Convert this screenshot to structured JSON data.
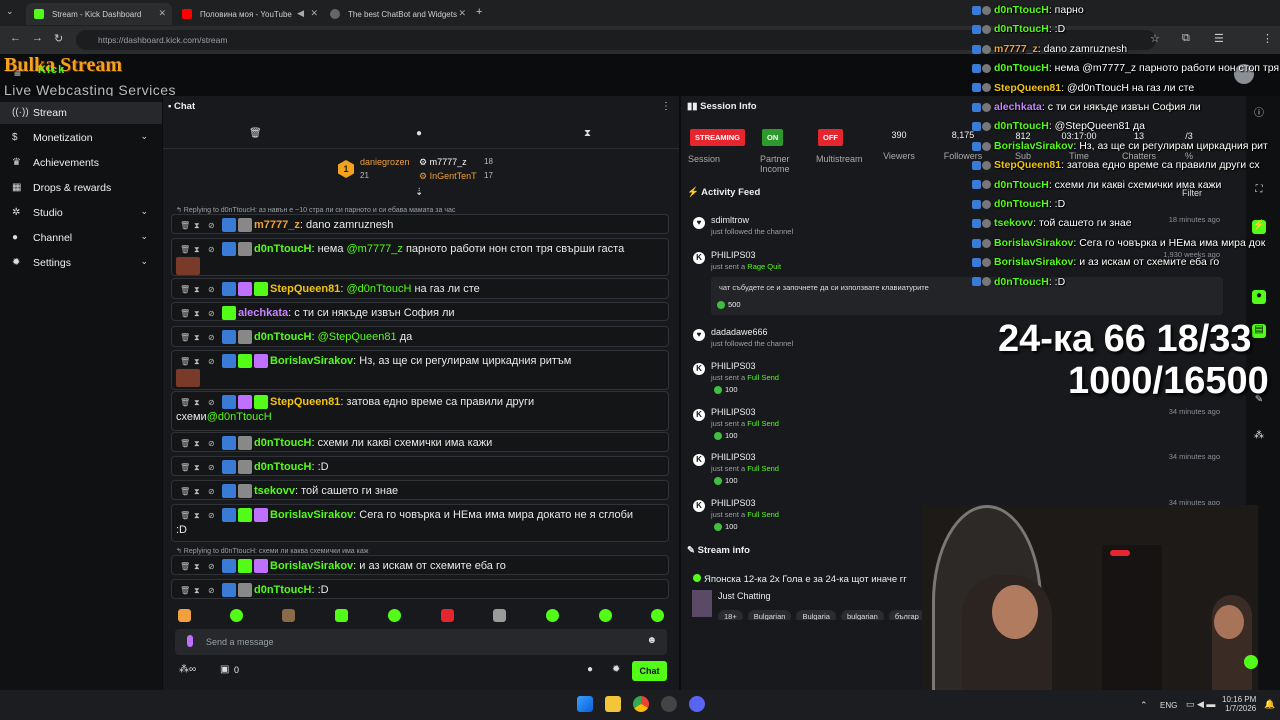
{
  "browser": {
    "tabs": [
      {
        "title": "Stream - Kick Dashboard",
        "fav_color": "#53fc18"
      },
      {
        "title": "Половина моя - YouTube",
        "fav_color": "#ff0000"
      },
      {
        "title": "The best ChatBot and Widgets",
        "fav_color": "#888888"
      }
    ],
    "url": "https://dashboard.kick.com/stream"
  },
  "logo": {
    "title": "Bulka Stream",
    "subtitle": "Live Webcasting Services",
    "badge": "Kick"
  },
  "sidebar": {
    "items": [
      {
        "label": "Stream",
        "icon": "stream-icon",
        "glyph": "((·))",
        "active": true
      },
      {
        "label": "Monetization",
        "icon": "dollar-icon",
        "glyph": "$",
        "chev": true
      },
      {
        "label": "Achievements",
        "icon": "trophy-icon",
        "glyph": "♛"
      },
      {
        "label": "Drops & rewards",
        "icon": "gift-icon",
        "glyph": "▦"
      },
      {
        "label": "Studio",
        "icon": "settings-icon",
        "glyph": "✲",
        "chev": true
      },
      {
        "label": "Channel",
        "icon": "user-icon",
        "glyph": "●",
        "chev": true
      },
      {
        "label": "Settings",
        "icon": "gear-icon",
        "glyph": "✹",
        "chev": true
      }
    ]
  },
  "chat": {
    "title": "Chat",
    "top_users": [
      {
        "name": "daniegrozen",
        "count": "21",
        "rank": "1"
      },
      {
        "name": "m7777_z",
        "count": "18"
      },
      {
        "name": "InGentTenT",
        "count": "17"
      }
    ],
    "reply1": "↰ Replying to d0nTtoucH: аз навън е ~10 стра ли си парното и си ебава мамата за час",
    "reply2": "↰ Replying to d0nTtoucH: схеми ли каква схемички има каж",
    "messages": [
      {
        "user": "m7777_z",
        "color": "#f0a03c",
        "text": ": dano zamruznesh"
      },
      {
        "user": "d0nTtoucH",
        "color": "#53fc18",
        "text": ": нема ",
        "mention": "@m7777_z",
        "text2": " парното работи нон стоп тря свърши гаста"
      },
      {
        "user": "StepQueen81",
        "color": "#f1c40f",
        "text": ": ",
        "mention": "@d0nTtoucH",
        "text2": " на газ ли сте"
      },
      {
        "user": "alechkata",
        "color": "#c784ff",
        "text": ": с ти си някъде извън София ли"
      },
      {
        "user": "d0nTtoucH",
        "color": "#53fc18",
        "text": ": ",
        "mention": "@StepQueen81",
        "text2": " да"
      },
      {
        "user": "BorislavSirakov",
        "color": "#53fc18",
        "text": ": Нз, аз ще си регулирам циркадния ритъм"
      },
      {
        "user": "StepQueen81",
        "color": "#f1c40f",
        "text": ": затова едно време са правили други",
        "line2": "схеми",
        "mention2": "@d0nTtoucH"
      },
      {
        "user": "d0nTtoucH",
        "color": "#53fc18",
        "text": ": схеми ли каквi схемички има кажи"
      },
      {
        "user": "d0nTtoucH",
        "color": "#53fc18",
        "text": ": :D"
      },
      {
        "user": "tsekovv",
        "color": "#53fc18",
        "text": ": той сашето ги знае"
      },
      {
        "user": "BorislavSirakov",
        "color": "#53fc18",
        "text": ": Сега го човърка и НЕма има мира докато не я сглоби",
        "line2": ":D"
      },
      {
        "user": "BorislavSirakov",
        "color": "#53fc18",
        "text": ": и аз искам от схемите еба го"
      },
      {
        "user": "d0nTtoucH",
        "color": "#53fc18",
        "text": ": :D"
      }
    ],
    "send_placeholder": "Send a message",
    "chat_button": "Chat",
    "counter": "0",
    "infinity": "∞"
  },
  "session": {
    "title": "Session Info",
    "pills": [
      {
        "label": "STREAMING",
        "sub": "Session",
        "color": "#e5262f"
      },
      {
        "label": "ON",
        "sub": "Partner Income",
        "color": "#2e9a2e"
      },
      {
        "label": "OFF",
        "sub": "Multistream",
        "color": "#e5262f"
      }
    ],
    "stats": [
      {
        "value": "390",
        "label": "Viewers"
      },
      {
        "value": "8,175",
        "label": "Followers"
      },
      {
        "value": "812",
        "label": "Sub"
      },
      {
        "value": "03:17:00",
        "label": "Time"
      },
      {
        "value": "13",
        "label": "Chatters"
      },
      {
        "value": "/3",
        "label": "%"
      }
    ]
  },
  "activity": {
    "title": "Activity Feed",
    "filter": "Filter",
    "items": [
      {
        "icon": "heart-icon",
        "glyph": "♥",
        "name": "sdimltrow",
        "sub": "just followed the channel",
        "time": "18 minutes ago"
      },
      {
        "icon": "kick-icon",
        "glyph": "K",
        "name": "PHILIPS03",
        "sub": "just sent a ",
        "reward": "Rage Quit",
        "time": "1,930 weeks ago",
        "note": "чат събудете се и започнете да си използвате клавиатурите",
        "amount": "500"
      },
      {
        "icon": "heart-icon",
        "glyph": "♥",
        "name": "dadadawe666",
        "sub": "just followed the channel",
        "time": ""
      },
      {
        "icon": "kick-icon",
        "glyph": "K",
        "name": "PHILIPS03",
        "sub": "just sent a ",
        "reward": "Full Send",
        "amount": "100",
        "time": ""
      },
      {
        "icon": "kick-icon",
        "glyph": "K",
        "name": "PHILIPS03",
        "sub": "just sent a ",
        "reward": "Full Send",
        "amount": "100",
        "time": "34 minutes ago"
      },
      {
        "icon": "kick-icon",
        "glyph": "K",
        "name": "PHILIPS03",
        "sub": "just sent a ",
        "reward": "Full Send",
        "amount": "100",
        "time": "34 minutes ago"
      },
      {
        "icon": "kick-icon",
        "glyph": "K",
        "name": "PHILIPS03",
        "sub": "just sent a ",
        "reward": "Full Send",
        "amount": "100",
        "time": "34 minutes ago"
      }
    ]
  },
  "stream_info": {
    "title": "Stream info",
    "stream_title": "Японска 12-ка 2х Гола е за 24-ка щот иначе гг",
    "category": "Just Chatting",
    "tags": [
      "18+",
      "Bulgarian",
      "Bulgaria",
      "bulgarian",
      "българ"
    ]
  },
  "overlay": {
    "lines": [
      {
        "user": "d0nTtoucH",
        "color": "#53fc18",
        "text": ": парно"
      },
      {
        "user": "d0nTtoucH",
        "color": "#53fc18",
        "text": ": :D"
      },
      {
        "user": "m7777_z",
        "color": "#f0a03c",
        "text": ": dano zamruznesh"
      },
      {
        "user": "d0nTtoucH",
        "color": "#53fc18",
        "text": ": нема @m7777_z парното работи нон стоп тря"
      },
      {
        "user": "StepQueen81",
        "color": "#f1c40f",
        "text": ": @d0nTtoucH на газ ли сте"
      },
      {
        "user": "alechkata",
        "color": "#c784ff",
        "text": ": с ти си някъде извън София ли"
      },
      {
        "user": "d0nTtoucH",
        "color": "#53fc18",
        "text": ": @StepQueen81 да"
      },
      {
        "user": "BorislavSirakov",
        "color": "#53fc18",
        "text": ": Нз, аз ще си регулирам циркадния рит"
      },
      {
        "user": "StepQueen81",
        "color": "#f1c40f",
        "text": ": затова едно време са правили други сх"
      },
      {
        "user": "d0nTtoucH",
        "color": "#53fc18",
        "text": ": схеми ли каквi схемички има кажи"
      },
      {
        "user": "d0nTtoucH",
        "color": "#53fc18",
        "text": ": :D"
      },
      {
        "user": "tsekovv",
        "color": "#53fc18",
        "text": ": той сашето ги знае"
      },
      {
        "user": "BorislavSirakov",
        "color": "#53fc18",
        "text": ": Сега го човърка и НЕма има мира док"
      },
      {
        "user": "BorislavSirakov",
        "color": "#53fc18",
        "text": ": и аз искам от схемите еба го"
      },
      {
        "user": "d0nTtoucH",
        "color": "#53fc18",
        "text": ": :D"
      }
    ],
    "big1": "24-ка 66 18/33",
    "big2": "1000/16500"
  },
  "taskbar": {
    "lang": "ENG",
    "time": "10:16 PM",
    "date": "1/7/2026"
  },
  "colors": {
    "accent": "#53fc18"
  }
}
